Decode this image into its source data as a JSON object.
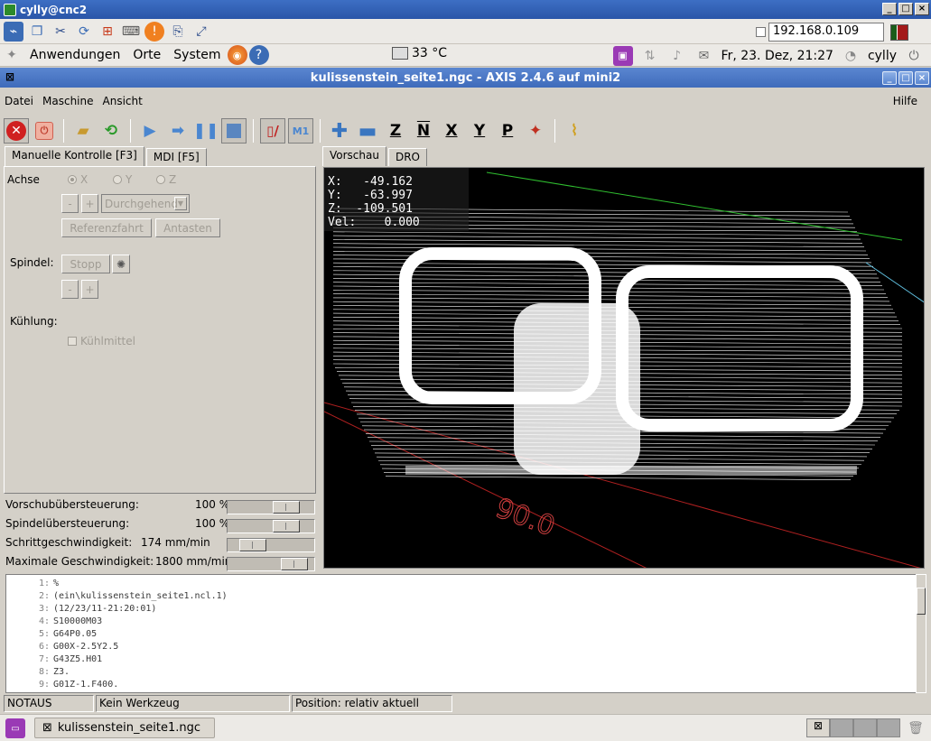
{
  "vnc": {
    "title": "cylly@cnc2"
  },
  "panel": {
    "ip": "192.168.0.109",
    "menus": [
      "Anwendungen",
      "Orte",
      "System"
    ],
    "temperature": "33 °C",
    "datetime": "Fr, 23. Dez, 21:27",
    "user": "cylly"
  },
  "app": {
    "title": "kulissenstein_seite1.ngc - AXIS 2.4.6 auf  mini2"
  },
  "menu": {
    "datei": "Datei",
    "maschine": "Maschine",
    "ansicht": "Ansicht",
    "hilfe": "Hilfe"
  },
  "tabs": {
    "manual": "Manuelle Kontrolle [F3]",
    "mdi": "MDI [F5]",
    "preview": "Vorschau",
    "dro": "DRO"
  },
  "manual": {
    "axis_label": "Achse",
    "axes": [
      "X",
      "Y",
      "Z"
    ],
    "jog_minus": "-",
    "jog_plus": "+",
    "jog_mode": "Durchgehend",
    "home_button": "Referenzfahrt",
    "touch_button": "Antasten",
    "spindle_label": "Spindel:",
    "stop_button": "Stopp",
    "cooling_label": "Kühlung:",
    "coolant": "Kühlmittel"
  },
  "sliders": [
    {
      "label": "Vorschubübersteuerung:",
      "value": "100 %",
      "level": 0.75
    },
    {
      "label": "Spindelübersteuerung:",
      "value": "100 %",
      "level": 0.75
    },
    {
      "label": "Schrittgeschwindigkeit:",
      "value": "174 mm/min",
      "level": 0.2
    },
    {
      "label": "Maximale Geschwindigkeit:",
      "value": "1800 mm/min",
      "level": 0.9
    }
  ],
  "dro": {
    "x": "X:   -49.162",
    "y": "Y:   -63.997",
    "z": "Z:  -109.501",
    "vel": "Vel:    0.000"
  },
  "preview": {
    "dimension": "90.0"
  },
  "gcode": [
    {
      "n": "1:",
      "text": "%"
    },
    {
      "n": "2:",
      "text": "(ein\\kulissenstein_seite1.ncl.1)"
    },
    {
      "n": "3:",
      "text": "(12/23/11-21:20:01)"
    },
    {
      "n": "4:",
      "text": "S10000M03"
    },
    {
      "n": "5:",
      "text": "G64P0.05"
    },
    {
      "n": "6:",
      "text": "G00X-2.5Y2.5"
    },
    {
      "n": "7:",
      "text": "G43Z5.H01"
    },
    {
      "n": "8:",
      "text": "Z3."
    },
    {
      "n": "9:",
      "text": "G01Z-1.F400."
    }
  ],
  "status": {
    "estop": "NOTAUS",
    "tool": "Kein Werkzeug",
    "position": "Position: relativ aktuell"
  },
  "taskbar": {
    "item": "kulissenstein_seite1.ngc"
  }
}
